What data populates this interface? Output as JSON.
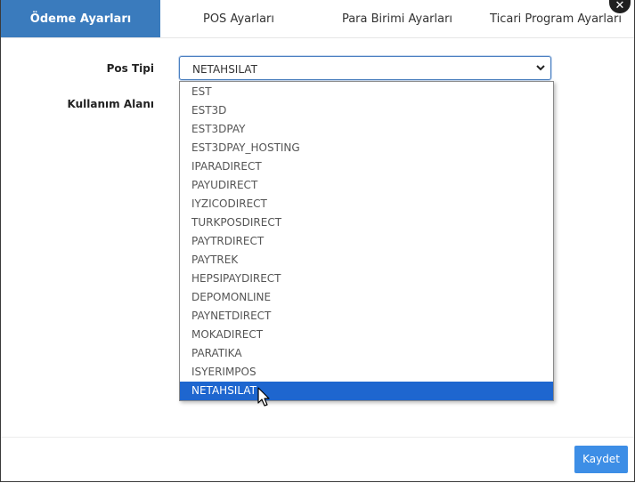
{
  "tabs": [
    {
      "label": "Ödeme Ayarları",
      "active": true
    },
    {
      "label": "POS Ayarları",
      "active": false
    },
    {
      "label": "Para Birimi Ayarları",
      "active": false
    },
    {
      "label": "Ticari Program Ayarları",
      "active": false
    }
  ],
  "close_icon": "close-icon",
  "form": {
    "pos_tipi_label": "Pos Tipi",
    "kullanim_alani_label": "Kullanım Alanı",
    "pos_tipi_value": "NETAHSILAT"
  },
  "dropdown": {
    "options": [
      "EST",
      "EST3D",
      "EST3DPAY",
      "EST3DPAY_HOSTING",
      "IPARADIRECT",
      "PAYUDIRECT",
      "IYZICODIRECT",
      "TURKPOSDIRECT",
      "PAYTRDIRECT",
      "PAYTREK",
      "HEPSIPAYDIRECT",
      "DEPOMONLINE",
      "PAYNETDIRECT",
      "MOKADIRECT",
      "PARATIKA",
      "ISYERIMPOS",
      "NETAHSILAT"
    ],
    "selected": "NETAHSILAT"
  },
  "footer": {
    "save_label": "Kaydet"
  },
  "colors": {
    "active_tab": "#3a7bbd",
    "selected_option": "#1e66cf",
    "save_button": "#3d8ee6"
  }
}
